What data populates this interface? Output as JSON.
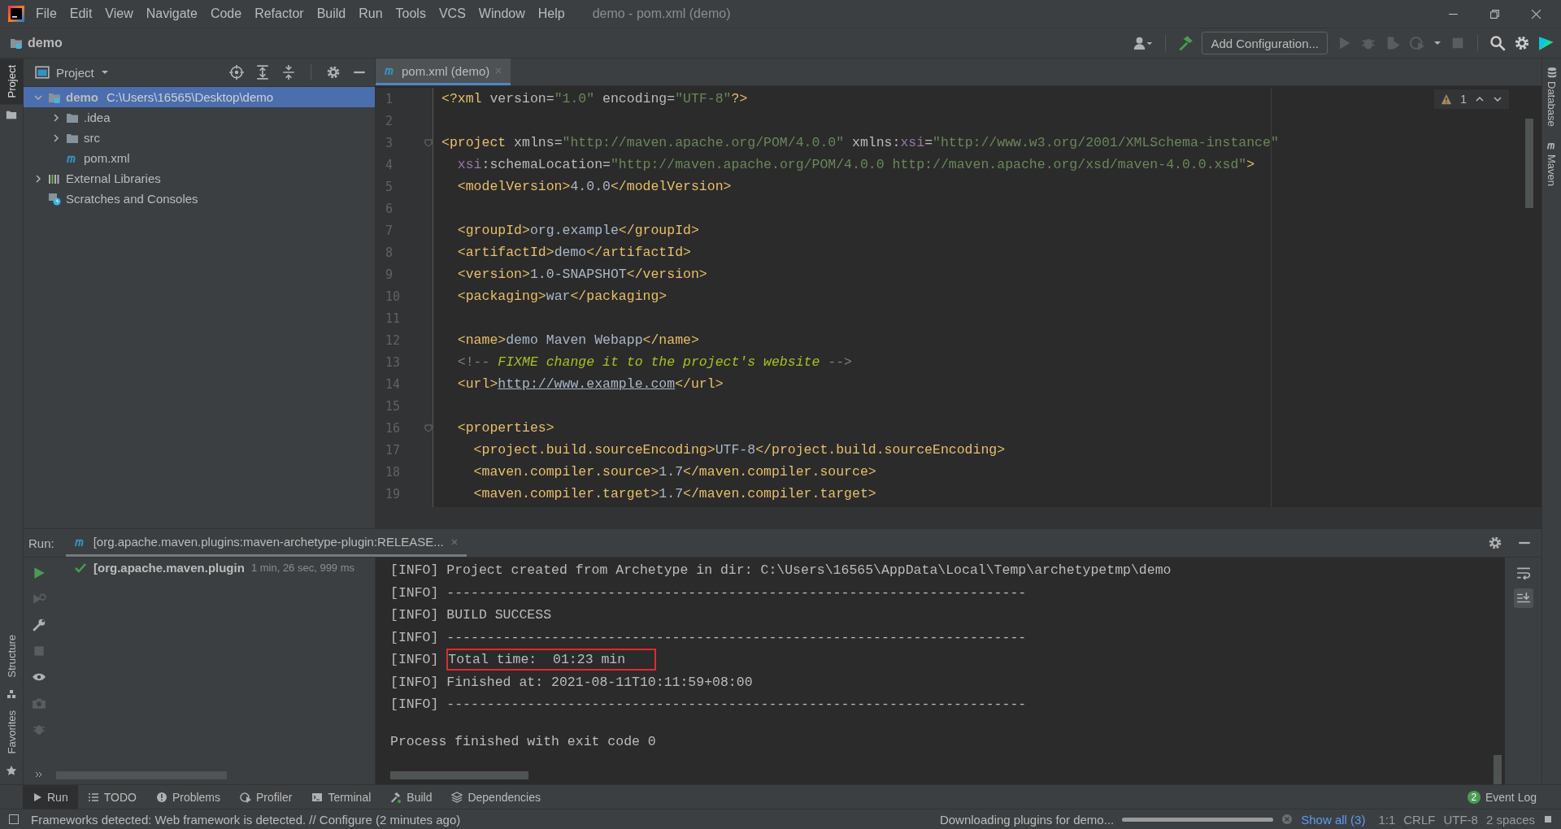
{
  "window": {
    "title": "demo - pom.xml (demo)"
  },
  "menu": [
    "File",
    "Edit",
    "View",
    "Navigate",
    "Code",
    "Refactor",
    "Build",
    "Run",
    "Tools",
    "VCS",
    "Window",
    "Help"
  ],
  "navigation": {
    "breadcrumb": "demo",
    "run_config": "Add Configuration..."
  },
  "left_strip": [
    {
      "label": "Project",
      "selected": true
    },
    {
      "label": "Structure",
      "selected": false
    },
    {
      "label": "Favorites",
      "selected": false
    }
  ],
  "right_strip": [
    {
      "label": "Database"
    },
    {
      "label": "Maven"
    }
  ],
  "project_panel": {
    "title": "Project",
    "tree": [
      {
        "kind": "module",
        "label": "demo",
        "path": "C:\\Users\\16565\\Desktop\\demo",
        "selected": true,
        "expanded": true,
        "children": [
          {
            "kind": "folder",
            "label": ".idea",
            "selected": false,
            "expanded": false
          },
          {
            "kind": "folder",
            "label": "src",
            "selected": false,
            "expanded": false
          },
          {
            "kind": "maven",
            "label": "pom.xml",
            "selected": false
          }
        ]
      },
      {
        "kind": "libraries",
        "label": "External Libraries",
        "selected": false,
        "expanded": false
      },
      {
        "kind": "scratches",
        "label": "Scratches and Consoles",
        "selected": false
      }
    ]
  },
  "editor": {
    "tabs": [
      {
        "label": "pom.xml (demo)",
        "selected": true
      }
    ],
    "warnings": "1",
    "lines": [
      {
        "number": "1",
        "fold": false,
        "tokens": [
          {
            "kind": "tag",
            "text": "<?xml"
          },
          {
            "kind": "attr",
            "text": " version="
          },
          {
            "kind": "str",
            "text": "\"1.0\""
          },
          {
            "kind": "attr",
            "text": " encoding="
          },
          {
            "kind": "str",
            "text": "\"UTF-8\""
          },
          {
            "kind": "tag",
            "text": "?>"
          }
        ]
      },
      {
        "number": "2",
        "fold": false
      },
      {
        "number": "3",
        "fold": true,
        "tokens": [
          {
            "kind": "tag",
            "text": "<project"
          },
          {
            "kind": "attr",
            "text": " xmlns="
          },
          {
            "kind": "str",
            "text": "\"http://maven.apache.org/POM/4.0.0\""
          },
          {
            "kind": "attr",
            "text": " xmlns:"
          },
          {
            "kind": "ns",
            "text": "xsi"
          },
          {
            "kind": "attr",
            "text": "="
          },
          {
            "kind": "str",
            "text": "\"http://www.w3.org/2001/XMLSchema-instance\""
          }
        ]
      },
      {
        "number": "4",
        "fold": false,
        "tokens": [
          {
            "kind": "ns",
            "text": "  xsi"
          },
          {
            "kind": "attr",
            "text": ":schemaLocation="
          },
          {
            "kind": "str",
            "text": "\"http://maven.apache.org/POM/4.0.0 http://maven.apache.org/xsd/maven-4.0.0.xsd\""
          },
          {
            "kind": "tag",
            "text": ">"
          }
        ]
      },
      {
        "number": "5",
        "fold": false,
        "tokens": [
          {
            "kind": "tag",
            "text": "  <modelVersion>"
          },
          {
            "kind": "text",
            "text": "4.0.0"
          },
          {
            "kind": "tag",
            "text": "</modelVersion>"
          }
        ]
      },
      {
        "number": "6",
        "fold": false
      },
      {
        "number": "7",
        "fold": false,
        "tokens": [
          {
            "kind": "tag",
            "text": "  <groupId>"
          },
          {
            "kind": "text",
            "text": "org.example"
          },
          {
            "kind": "tag",
            "text": "</groupId>"
          }
        ]
      },
      {
        "number": "8",
        "fold": false,
        "tokens": [
          {
            "kind": "tag",
            "text": "  <artifactId>"
          },
          {
            "kind": "text",
            "text": "demo"
          },
          {
            "kind": "tag",
            "text": "</artifactId>"
          }
        ]
      },
      {
        "number": "9",
        "fold": false,
        "tokens": [
          {
            "kind": "tag",
            "text": "  <version>"
          },
          {
            "kind": "text",
            "text": "1.0-SNAPSHOT"
          },
          {
            "kind": "tag",
            "text": "</version>"
          }
        ]
      },
      {
        "number": "10",
        "fold": false,
        "tokens": [
          {
            "kind": "tag",
            "text": "  <packaging>"
          },
          {
            "kind": "text",
            "text": "war"
          },
          {
            "kind": "tag",
            "text": "</packaging>"
          }
        ]
      },
      {
        "number": "11",
        "fold": false
      },
      {
        "number": "12",
        "fold": false,
        "tokens": [
          {
            "kind": "tag",
            "text": "  <name>"
          },
          {
            "kind": "text",
            "text": "demo Maven Webapp"
          },
          {
            "kind": "tag",
            "text": "</name>"
          }
        ]
      },
      {
        "number": "13",
        "fold": false,
        "tokens": [
          {
            "kind": "comment",
            "text": "  <!-- "
          },
          {
            "kind": "todo",
            "text": "FIXME change it to the project's website"
          },
          {
            "kind": "comment",
            "text": " -->"
          }
        ]
      },
      {
        "number": "14",
        "fold": false,
        "tokens": [
          {
            "kind": "tag",
            "text": "  <url>"
          },
          {
            "kind": "link",
            "text": "http://www.example.com"
          },
          {
            "kind": "tag",
            "text": "</url>"
          }
        ]
      },
      {
        "number": "15",
        "fold": false
      },
      {
        "number": "16",
        "fold": true,
        "tokens": [
          {
            "kind": "tag",
            "text": "  <properties>"
          }
        ]
      },
      {
        "number": "17",
        "fold": false,
        "tokens": [
          {
            "kind": "tag",
            "text": "    <project.build.sourceEncoding>"
          },
          {
            "kind": "text",
            "text": "UTF-8"
          },
          {
            "kind": "tag",
            "text": "</project.build.sourceEncoding>"
          }
        ]
      },
      {
        "number": "18",
        "fold": false,
        "tokens": [
          {
            "kind": "tag",
            "text": "    <maven.compiler.source>"
          },
          {
            "kind": "text",
            "text": "1.7"
          },
          {
            "kind": "tag",
            "text": "</maven.compiler.source>"
          }
        ]
      },
      {
        "number": "19",
        "fold": false,
        "tokens": [
          {
            "kind": "tag",
            "text": "    <maven.compiler.target>"
          },
          {
            "kind": "text",
            "text": "1.7"
          },
          {
            "kind": "tag",
            "text": "</maven.compiler.target>"
          }
        ]
      }
    ]
  },
  "run_panel": {
    "label": "Run:",
    "tab": "[org.apache.maven.plugins:maven-archetype-plugin:RELEASE...",
    "tree": [
      {
        "label": "[org.apache.maven.plugin",
        "duration": "1 min, 26 sec, 999 ms",
        "success": true
      }
    ],
    "console": [
      {
        "kind": "line",
        "text": "[INFO] Project created from Archetype in dir: C:\\Users\\16565\\AppData\\Local\\Temp\\archetypetmp\\demo"
      },
      {
        "kind": "line",
        "text": "[INFO] ------------------------------------------------------------------------"
      },
      {
        "kind": "line",
        "text": "[INFO] BUILD SUCCESS"
      },
      {
        "kind": "line",
        "text": "[INFO] ------------------------------------------------------------------------"
      },
      {
        "kind": "line",
        "text": "[INFO] ",
        "highlight_text": "Total time:  01:23 min"
      },
      {
        "kind": "line",
        "text": "[INFO] Finished at: 2021-08-11T10:11:59+08:00"
      },
      {
        "kind": "line",
        "text": "[INFO] ------------------------------------------------------------------------"
      },
      {
        "kind": "blank"
      },
      {
        "kind": "line",
        "text": "Process finished with exit code 0"
      }
    ]
  },
  "tool_tabs": [
    {
      "label": "Run",
      "selected": true
    },
    {
      "label": "TODO",
      "selected": false
    },
    {
      "label": "Problems",
      "selected": false
    },
    {
      "label": "Profiler",
      "selected": false
    },
    {
      "label": "Terminal",
      "selected": false
    },
    {
      "label": "Build",
      "selected": false
    },
    {
      "label": "Dependencies",
      "selected": false
    }
  ],
  "event_log": {
    "count": "2",
    "label": "Event Log"
  },
  "status_bar": {
    "message": "Frameworks detected: Web framework is detected. // Configure (2 minutes ago)",
    "task": "Downloading plugins for demo...",
    "level": 1,
    "show_all": "Show all (3)",
    "items": [
      "1:1",
      "CRLF",
      "UTF-8",
      "2 spaces"
    ]
  }
}
